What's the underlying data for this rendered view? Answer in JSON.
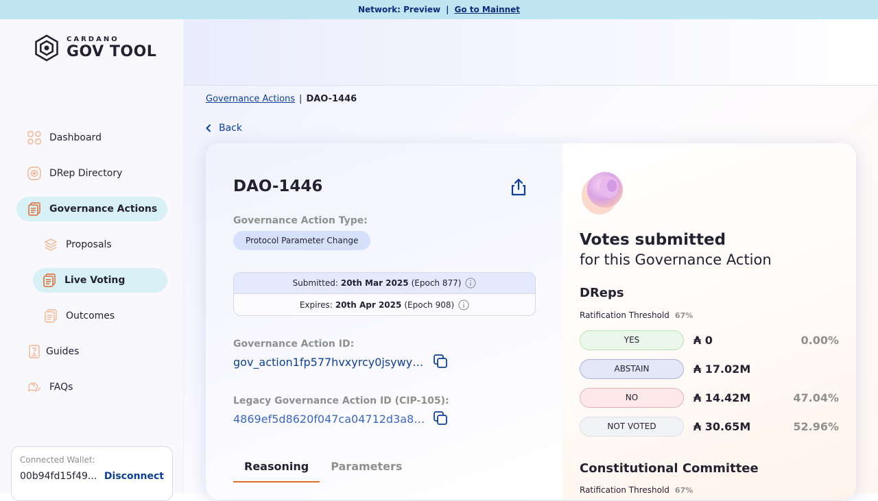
{
  "banner": {
    "text": "Network: Preview",
    "separator": "|",
    "link": "Go to Mainnet"
  },
  "logo": {
    "top": "CARDANO",
    "bottom": "GOV TOOL"
  },
  "sidebar": {
    "items": [
      {
        "label": "Dashboard",
        "icon": "dashboard-icon"
      },
      {
        "label": "DRep Directory",
        "icon": "drep-directory-icon"
      },
      {
        "label": "Governance Actions",
        "icon": "governance-actions-icon"
      },
      {
        "label": "Proposals",
        "icon": "proposals-icon"
      },
      {
        "label": "Live Voting",
        "icon": "live-voting-icon"
      },
      {
        "label": "Outcomes",
        "icon": "outcomes-icon"
      },
      {
        "label": "Guides",
        "icon": "guides-icon"
      },
      {
        "label": "FAQs",
        "icon": "faqs-icon"
      }
    ]
  },
  "wallet": {
    "label": "Connected Wallet:",
    "address": "00b94fd15f49...",
    "disconnect": "Disconnect"
  },
  "breadcrumb": {
    "link": "Governance Actions",
    "separator": "|",
    "current": "DAO-1446"
  },
  "back_label": "Back",
  "action": {
    "title": "DAO-1446",
    "type_label": "Governance Action Type:",
    "type_value": "Protocol Parameter Change",
    "submitted": {
      "prefix": "Submitted:",
      "date": "20th Mar 2025",
      "epoch": "(Epoch 877)"
    },
    "expires": {
      "prefix": "Expires:",
      "date": "20th Apr 2025",
      "epoch": "(Epoch 908)"
    },
    "id_label": "Governance Action ID:",
    "id_value": "gov_action1fp577hvxyrcy0jsywyk...",
    "legacy_label": "Legacy Governance Action ID (CIP-105):",
    "legacy_value": "4869ef5d8620f047ca04712d3a8f1...",
    "tabs": [
      "Reasoning",
      "Parameters"
    ]
  },
  "votes": {
    "title": "Votes submitted",
    "subtitle": "for this Governance Action",
    "dreps": {
      "heading": "DReps",
      "threshold_label": "Ratification Threshold",
      "threshold_value": "67%",
      "rows": [
        {
          "label": "YES",
          "amount": "₳ 0",
          "pct": "0.00%",
          "bg": "#eaf7ea",
          "border": "#b9e3b9"
        },
        {
          "label": "ABSTAIN",
          "amount": "₳ 17.02M",
          "pct": "",
          "bg": "#e3e7f7",
          "border": "#a9b4db"
        },
        {
          "label": "NO",
          "amount": "₳ 14.42M",
          "pct": "47.04%",
          "bg": "#fde8e8",
          "border": "#eab2b2"
        },
        {
          "label": "NOT VOTED",
          "amount": "₳ 30.65M",
          "pct": "52.96%",
          "bg": "#f2f3f6",
          "border": "#dcdde3"
        }
      ]
    },
    "cc": {
      "heading": "Constitutional Committee",
      "threshold_label": "Ratification Threshold",
      "threshold_value": "67%"
    }
  },
  "colors": {
    "accent_orange": "#e06b2d",
    "link_blue": "#0b3f9c",
    "active_nav": "#d7f1f7"
  }
}
